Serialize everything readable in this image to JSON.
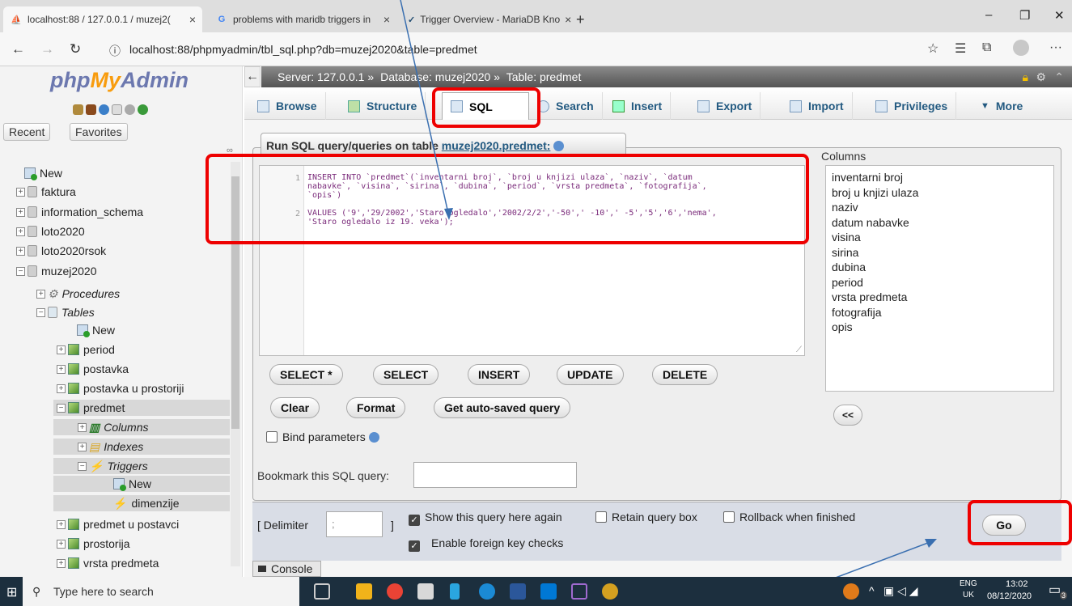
{
  "browser": {
    "tabs": [
      {
        "label": "localhost:88 / 127.0.0.1 / muzej2(",
        "icon": "pma-icon"
      },
      {
        "label": "problems with maridb triggers in",
        "icon": "google-icon"
      },
      {
        "label": "Trigger Overview - MariaDB Kno",
        "icon": "mariadb-icon"
      }
    ],
    "new_tab": "+",
    "url": "localhost:88/phpmyadmin/tbl_sql.php?db=muzej2020&table=predmet"
  },
  "pma": {
    "logo_php": "php",
    "logo_my": "My",
    "logo_admin": "Admin",
    "recent": "Recent",
    "favorites": "Favorites",
    "tree": {
      "new": "New",
      "faktura": "faktura",
      "information_schema": "information_schema",
      "loto2020": "loto2020",
      "loto2020rsok": "loto2020rsok",
      "muzej2020": "muzej2020",
      "procedures": "Procedures",
      "tables": "Tables",
      "tables_new": "New",
      "period": "period",
      "postavka": "postavka",
      "postavka_u_prostoriji": "postavka u prostoriji",
      "predmet": "predmet",
      "columns": "Columns",
      "indexes": "Indexes",
      "triggers": "Triggers",
      "triggers_new": "New",
      "dimenzije": "dimenzije",
      "predmet_u_postavci": "predmet u postavci",
      "prostorija": "prostorija",
      "vrsta_predmeta": "vrsta predmeta"
    },
    "breadcrumb": {
      "server": "Server: 127.0.0.1",
      "database": "Database: muzej2020",
      "table": "Table: predmet",
      "sep": "»"
    },
    "tabs": {
      "browse": "Browse",
      "structure": "Structure",
      "sql": "SQL",
      "search": "Search",
      "insert": "Insert",
      "export": "Export",
      "import": "Import",
      "privileges": "Privileges",
      "more": "More"
    },
    "run_label": "Run SQL query/queries on table ",
    "run_table": "muzej2020.predmet:",
    "sql": {
      "line1": "1",
      "line2": "2",
      "l1a": "INSERT INTO `predmet`(`inventarni broj`, `broj u knjizi ulaza`, `naziv`, `datum",
      "l1b": "nabavke`, `visina`, `sirina`, `dubina`, `period`, `vrsta predmeta`, `fotografija`,",
      "l1c": "`opis`)",
      "l2a": "VALUES ('9','29/2002','Staro ogledalo','2002/2/2','-50',' -10',' -5','5','6','nema',",
      "l2b": "'Staro ogledalo iz 19. veka');"
    },
    "buttons": {
      "select_star": "SELECT *",
      "select": "SELECT",
      "insert": "INSERT",
      "update": "UPDATE",
      "delete": "DELETE",
      "clear": "Clear",
      "format": "Format",
      "autosaved": "Get auto-saved query",
      "insert_col": "<<",
      "go": "Go"
    },
    "columns_label": "Columns",
    "columns": [
      "inventarni broj",
      "broj u knjizi ulaza",
      "naziv",
      "datum nabavke",
      "visina",
      "sirina",
      "dubina",
      "period",
      "vrsta predmeta",
      "fotografija",
      "opis"
    ],
    "bind_params": "Bind parameters",
    "bookmark_label": "Bookmark this SQL query:",
    "delimiter_label": "[ Delimiter",
    "delimiter_value": ";",
    "delimiter_close": "]",
    "show_query": "Show this query here again",
    "retain": "Retain query box",
    "rollback": "Rollback when finished",
    "fk_checks": "Enable foreign key checks",
    "console": "Console"
  },
  "taskbar": {
    "search_placeholder": "Type here to search",
    "lang1": "ENG",
    "lang2": "UK",
    "time": "13:02",
    "date": "08/12/2020",
    "notif": "3"
  },
  "colors": {
    "highlight": "#e00000",
    "pma_blue": "#235a81",
    "arrow": "#3a6fb0"
  }
}
